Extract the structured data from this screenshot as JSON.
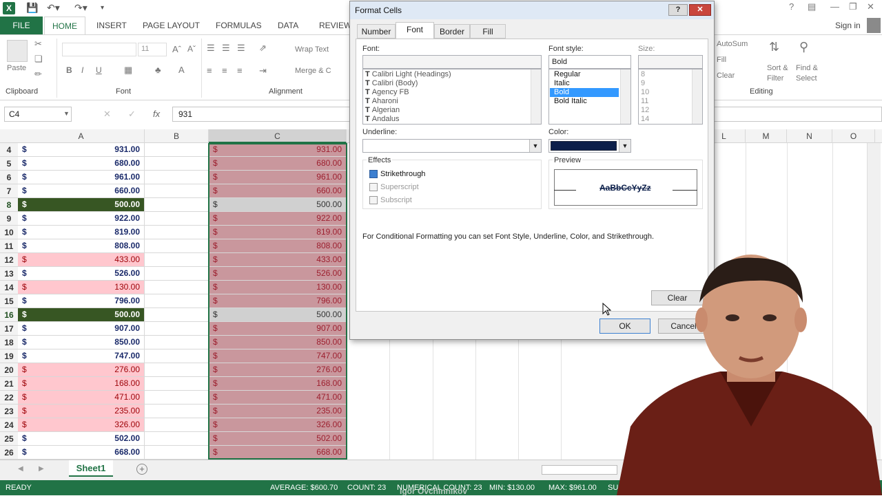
{
  "titlebar": {
    "signin": "Sign in",
    "help": "?"
  },
  "tabs": {
    "file": "FILE",
    "home": "HOME",
    "insert": "INSERT",
    "page_layout": "PAGE LAYOUT",
    "formulas": "FORMULAS",
    "data": "DATA",
    "review": "REVIEW"
  },
  "ribbon": {
    "paste": "Paste",
    "font_size": "11",
    "wrap_text": "Wrap Text",
    "merge": "Merge & C",
    "autosum": "AutoSum",
    "fill": "Fill",
    "clear": "Clear",
    "sort_filter": "Sort &\nFilter",
    "find_select": "Find &\nSelect",
    "groups": {
      "clipboard": "Clipboard",
      "font": "Font",
      "alignment": "Alignment",
      "editing": "Editing"
    }
  },
  "formula_bar": {
    "name_box": "C4",
    "fx": "fx",
    "value": "931"
  },
  "columns": {
    "a": "A",
    "b": "B",
    "c": "C",
    "l": "L",
    "m": "M",
    "n": "N",
    "o": "O"
  },
  "rows": [
    {
      "n": "4",
      "a": "931.00",
      "c": "931.00",
      "a_style": "normal",
      "c_style": "rose"
    },
    {
      "n": "5",
      "a": "680.00",
      "c": "680.00",
      "a_style": "normal",
      "c_style": "rose"
    },
    {
      "n": "6",
      "a": "961.00",
      "c": "961.00",
      "a_style": "normal",
      "c_style": "rose"
    },
    {
      "n": "7",
      "a": "660.00",
      "c": "660.00",
      "a_style": "normal",
      "c_style": "rose"
    },
    {
      "n": "8",
      "a": "500.00",
      "c": "500.00",
      "a_style": "green",
      "c_style": "gray"
    },
    {
      "n": "9",
      "a": "922.00",
      "c": "922.00",
      "a_style": "normal",
      "c_style": "rose"
    },
    {
      "n": "10",
      "a": "819.00",
      "c": "819.00",
      "a_style": "normal",
      "c_style": "rose"
    },
    {
      "n": "11",
      "a": "808.00",
      "c": "808.00",
      "a_style": "normal",
      "c_style": "rose"
    },
    {
      "n": "12",
      "a": "433.00",
      "c": "433.00",
      "a_style": "pink",
      "c_style": "rose"
    },
    {
      "n": "13",
      "a": "526.00",
      "c": "526.00",
      "a_style": "normal",
      "c_style": "rose"
    },
    {
      "n": "14",
      "a": "130.00",
      "c": "130.00",
      "a_style": "pink",
      "c_style": "rose"
    },
    {
      "n": "15",
      "a": "796.00",
      "c": "796.00",
      "a_style": "normal",
      "c_style": "rose"
    },
    {
      "n": "16",
      "a": "500.00",
      "c": "500.00",
      "a_style": "green",
      "c_style": "gray"
    },
    {
      "n": "17",
      "a": "907.00",
      "c": "907.00",
      "a_style": "normal",
      "c_style": "rose"
    },
    {
      "n": "18",
      "a": "850.00",
      "c": "850.00",
      "a_style": "normal",
      "c_style": "rose"
    },
    {
      "n": "19",
      "a": "747.00",
      "c": "747.00",
      "a_style": "normal",
      "c_style": "rose"
    },
    {
      "n": "20",
      "a": "276.00",
      "c": "276.00",
      "a_style": "pink",
      "c_style": "rose"
    },
    {
      "n": "21",
      "a": "168.00",
      "c": "168.00",
      "a_style": "pink",
      "c_style": "rose"
    },
    {
      "n": "22",
      "a": "471.00",
      "c": "471.00",
      "a_style": "pink",
      "c_style": "rose"
    },
    {
      "n": "23",
      "a": "235.00",
      "c": "235.00",
      "a_style": "pink",
      "c_style": "rose"
    },
    {
      "n": "24",
      "a": "326.00",
      "c": "326.00",
      "a_style": "pink",
      "c_style": "rose"
    },
    {
      "n": "25",
      "a": "502.00",
      "c": "502.00",
      "a_style": "normal",
      "c_style": "rose"
    },
    {
      "n": "26",
      "a": "668.00",
      "c": "668.00",
      "a_style": "normal",
      "c_style": "rose"
    }
  ],
  "currency_symbol": "$",
  "sheet": {
    "tab": "Sheet1",
    "add": "+"
  },
  "status": {
    "ready": "READY",
    "average": "AVERAGE: $600.70",
    "count": "COUNT: 23",
    "numerical_count": "NUMERICAL COUNT: 23",
    "min": "MIN: $130.00",
    "max": "MAX: $961.00",
    "sum": "SU",
    "watermark": "Igor Ovchinnikov"
  },
  "dialog": {
    "title": "Format Cells",
    "tabs": [
      "Number",
      "Font",
      "Border",
      "Fill"
    ],
    "active_tab": "Font",
    "font_label": "Font:",
    "fonts": [
      "Calibri Light (Headings)",
      "Calibri (Body)",
      "Agency FB",
      "Aharoni",
      "Algerian",
      "Andalus"
    ],
    "style_label": "Font style:",
    "style_value": "Bold",
    "styles": [
      "Regular",
      "Italic",
      "Bold",
      "Bold Italic"
    ],
    "selected_style": "Bold",
    "size_label": "Size:",
    "sizes": [
      "8",
      "9",
      "10",
      "11",
      "12",
      "14"
    ],
    "underline_label": "Underline:",
    "color_label": "Color:",
    "color_value": "#0c1f4a",
    "effects_label": "Effects",
    "strikethrough": "Strikethrough",
    "superscript": "Superscript",
    "subscript": "Subscript",
    "preview_label": "Preview",
    "preview_text": "AaBbCcYyZz",
    "note": "For Conditional Formatting you can set Font Style, Underline, Color, and Strikethrough.",
    "clear": "Clear",
    "ok": "OK",
    "cancel": "Cancel"
  },
  "colors": {
    "excel_green": "#217346",
    "pink_fill": "#ffc7ce",
    "dark_green_fill": "#375623",
    "rose_fill": "#c9979d",
    "gray_fill": "#d0d0d0"
  }
}
